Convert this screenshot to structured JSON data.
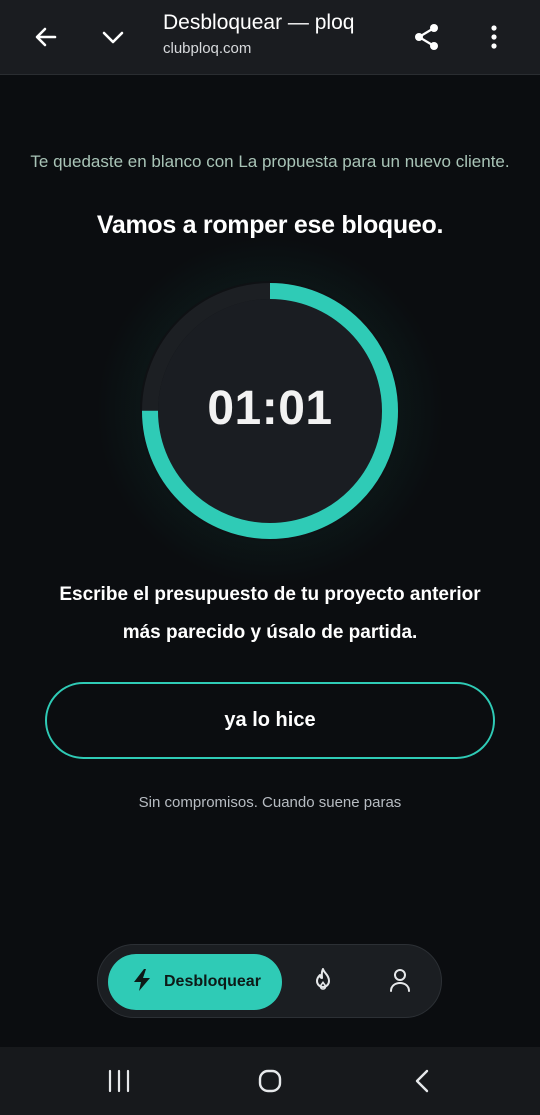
{
  "browser": {
    "title": "Desbloquear — ploq",
    "url": "clubploq.com",
    "icons": [
      "back-arrow-icon",
      "chevron-down-icon",
      "share-icon",
      "more-vertical-icon"
    ]
  },
  "main": {
    "context": "Te quedaste en blanco con La propuesta para un nuevo cliente.",
    "headline": "Vamos a romper ese bloqueo.",
    "timer": {
      "display": "01:01",
      "progress": 0.75,
      "accent": "#2fcbb6"
    },
    "instruction": "Escribe el presupuesto de tu proyecto anterior más parecido y úsalo de partida.",
    "done_button": "ya lo hice",
    "note": "Sin compromisos. Cuando suene paras"
  },
  "bottom_nav": {
    "active_label": "Desbloquear",
    "items": [
      {
        "name": "desbloquear",
        "icon": "bolt-icon",
        "active": true
      },
      {
        "name": "racha",
        "icon": "flame-icon",
        "active": false
      },
      {
        "name": "perfil",
        "icon": "user-icon",
        "active": false
      }
    ]
  },
  "system_nav": {
    "icons": [
      "recents-icon",
      "home-icon",
      "back-icon"
    ]
  },
  "colors": {
    "background": "#0b0d10",
    "accent": "#2fcbb6",
    "bar": "#1a1c20"
  }
}
